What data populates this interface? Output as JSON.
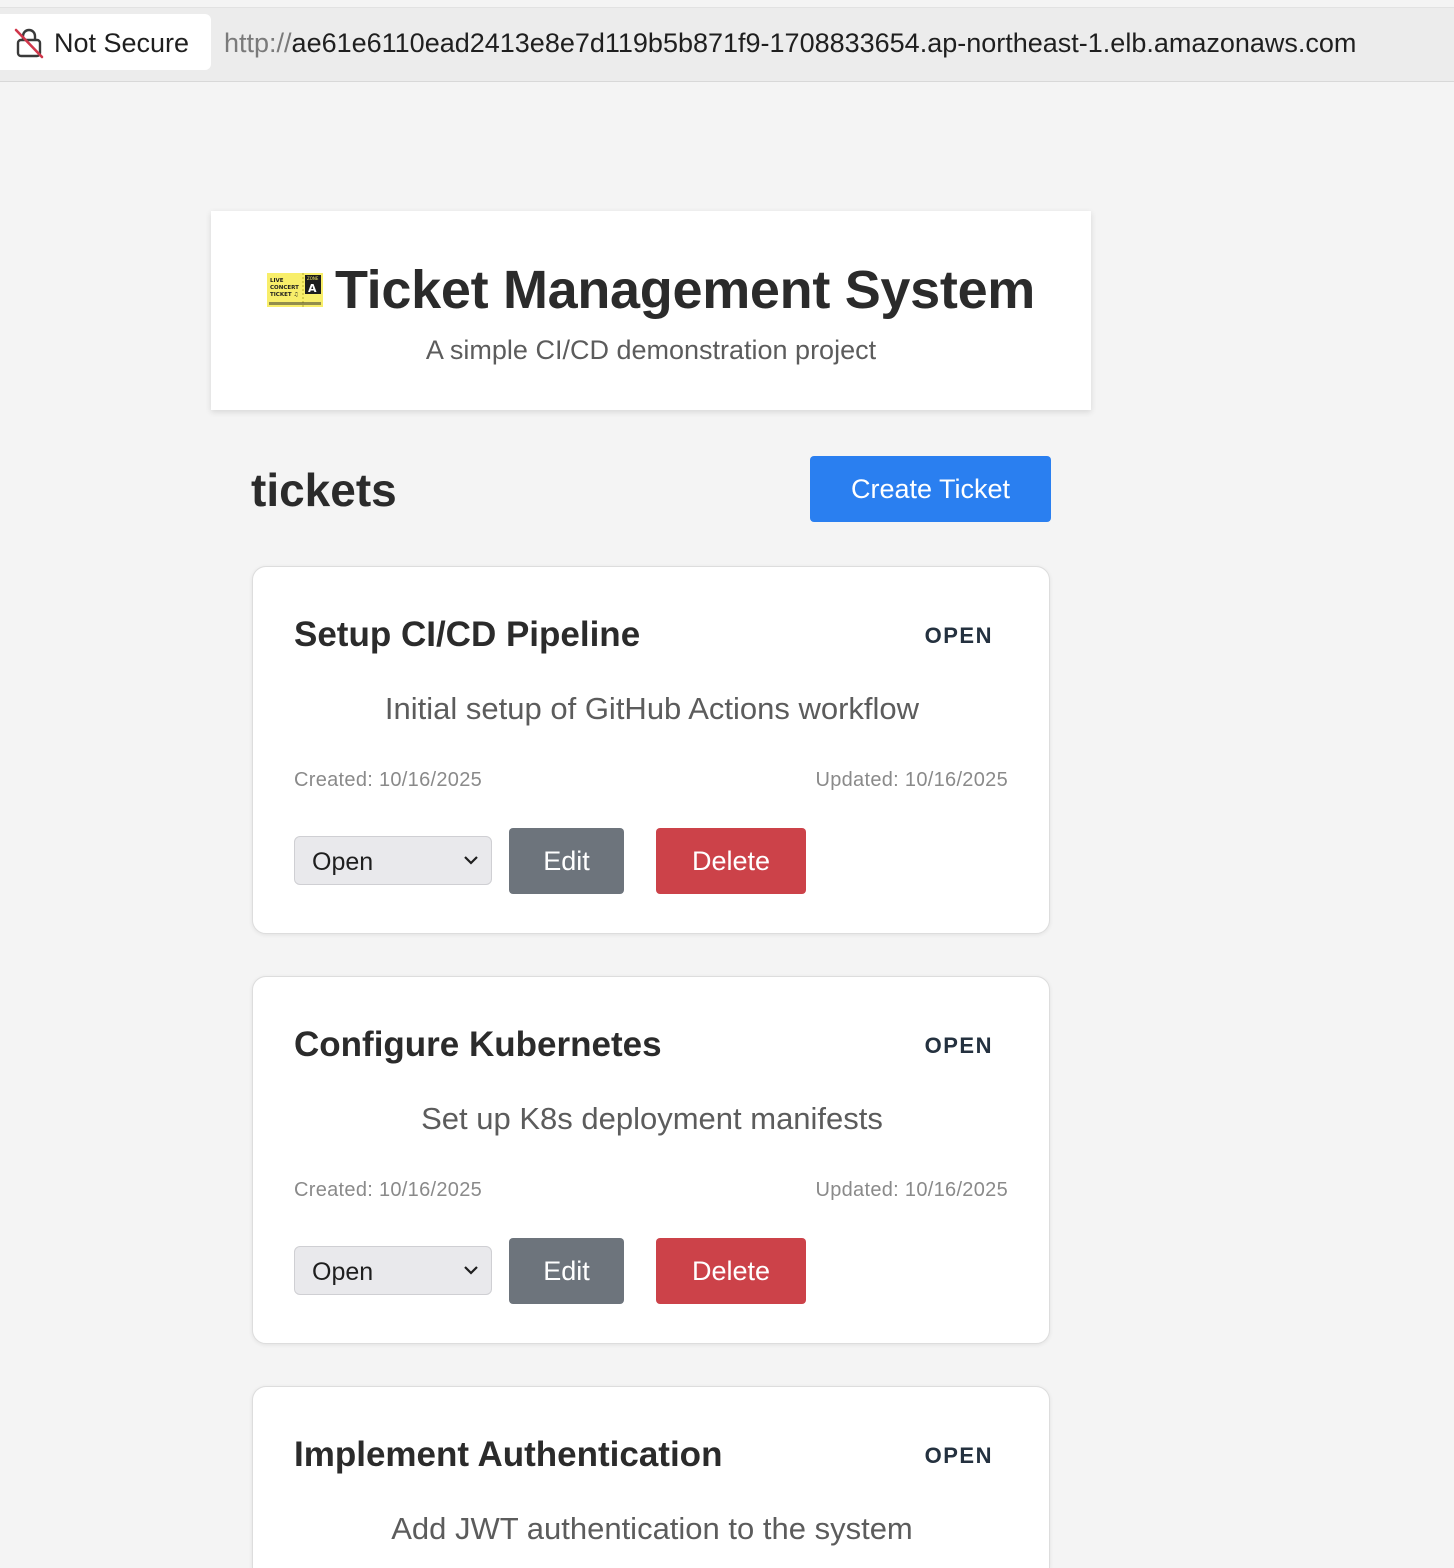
{
  "browser": {
    "security_label": "Not Secure",
    "url_scheme": "http://",
    "url_host": "ae61e6110ead2413e8e7d119b5b871f9-1708833654.ap-northeast-1.elb.amazonaws.com",
    "security_icon": "lock-slash-icon"
  },
  "header": {
    "icon": "ticket-icon",
    "icon_lines": [
      "LIVE",
      "CONCERT",
      "TICKET ♫",
      "ZONE",
      "A"
    ],
    "title": "Ticket Management System",
    "subtitle": "A simple CI/CD demonstration project"
  },
  "section": {
    "title": "tickets",
    "create_label": "Create Ticket"
  },
  "colors": {
    "primary": "#2a7ff0",
    "secondary": "#6d747c",
    "danger": "#cc4249",
    "background": "#f4f4f4"
  },
  "tickets": [
    {
      "title": "Setup CI/CD Pipeline",
      "status": "OPEN",
      "description": "Initial setup of GitHub Actions workflow",
      "created": "Created: 10/16/2025",
      "updated": "Updated: 10/16/2025",
      "status_value": "Open",
      "edit_label": "Edit",
      "delete_label": "Delete"
    },
    {
      "title": "Configure Kubernetes",
      "status": "OPEN",
      "description": "Set up K8s deployment manifests",
      "created": "Created: 10/16/2025",
      "updated": "Updated: 10/16/2025",
      "status_value": "Open",
      "edit_label": "Edit",
      "delete_label": "Delete"
    },
    {
      "title": "Implement Authentication",
      "status": "OPEN",
      "description": "Add JWT authentication to the system"
    }
  ]
}
